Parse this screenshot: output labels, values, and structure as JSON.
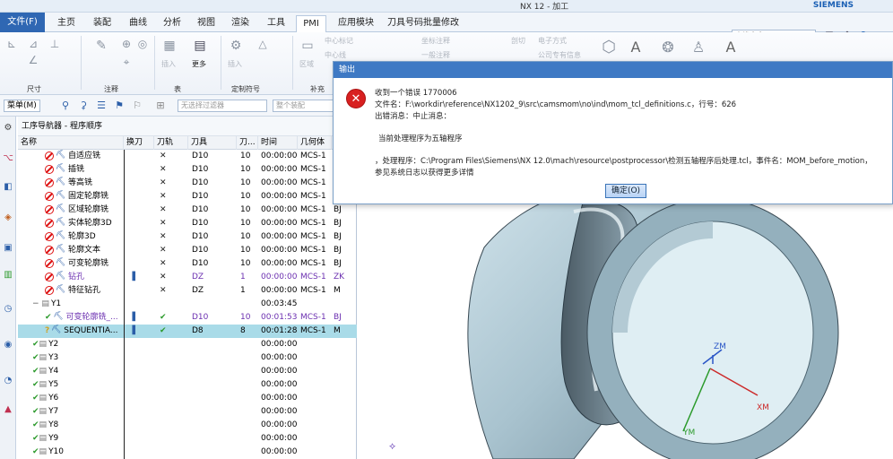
{
  "window": {
    "title": "NX 12 - 加工",
    "brand": "SIEMENS"
  },
  "ribbon": {
    "tabs": [
      "文件(F)",
      "主页",
      "装配",
      "曲线",
      "分析",
      "视图",
      "渲染",
      "工具",
      "PMI",
      "应用模块",
      "刀具号码批量修改"
    ],
    "active_tab": "PMI",
    "command_search_placeholder": "查找命令",
    "groups": [
      "尺寸",
      "注释",
      "表",
      "定制符号",
      "补充"
    ],
    "more_label": "更多",
    "small_labels": [
      "中心标记",
      "坐标注释",
      "一般注释",
      "中心线",
      "剖切",
      "公司专有信息",
      "电子方式",
      "区域",
      "插入",
      "插入"
    ]
  },
  "toolbar2": {
    "menu_label": "菜单(M)",
    "filter_placeholder": "无选择过滤器",
    "assembly_placeholder": "整个装配"
  },
  "navigator": {
    "title": "工序导航器 - 程序顺序",
    "columns": [
      "名称",
      "换刀",
      "刀轨",
      "刀具",
      "刀...",
      "时间",
      "几何体"
    ],
    "rows": [
      {
        "name": "自适应铣",
        "state": "stop",
        "path": "x",
        "tool": "D10",
        "num": "10",
        "time": "00:00:00",
        "geom": "MCS-1",
        "extra": "",
        "indent": 2,
        "style": ""
      },
      {
        "name": "插铣",
        "state": "stop",
        "path": "x",
        "tool": "D10",
        "num": "10",
        "time": "00:00:00",
        "geom": "MCS-1",
        "extra": "",
        "indent": 2,
        "style": ""
      },
      {
        "name": "等高铣",
        "state": "stop",
        "path": "x",
        "tool": "D10",
        "num": "10",
        "time": "00:00:00",
        "geom": "MCS-1",
        "extra": "",
        "indent": 2,
        "style": ""
      },
      {
        "name": "固定轮廓铣",
        "state": "stop",
        "path": "x",
        "tool": "D10",
        "num": "10",
        "time": "00:00:00",
        "geom": "MCS-1",
        "extra": "",
        "indent": 2,
        "style": ""
      },
      {
        "name": "区域轮廓铣",
        "state": "stop",
        "path": "x",
        "tool": "D10",
        "num": "10",
        "time": "00:00:00",
        "geom": "MCS-1",
        "extra": "BJ",
        "indent": 2,
        "style": ""
      },
      {
        "name": "实体轮廓3D",
        "state": "stop",
        "path": "x",
        "tool": "D10",
        "num": "10",
        "time": "00:00:00",
        "geom": "MCS-1",
        "extra": "BJ",
        "indent": 2,
        "style": ""
      },
      {
        "name": "轮廓3D",
        "state": "stop",
        "path": "x",
        "tool": "D10",
        "num": "10",
        "time": "00:00:00",
        "geom": "MCS-1",
        "extra": "BJ",
        "indent": 2,
        "style": ""
      },
      {
        "name": "轮廓文本",
        "state": "stop",
        "path": "x",
        "tool": "D10",
        "num": "10",
        "time": "00:00:00",
        "geom": "MCS-1",
        "extra": "BJ",
        "indent": 2,
        "style": ""
      },
      {
        "name": "可变轮廓铣",
        "state": "stop",
        "path": "x",
        "tool": "D10",
        "num": "10",
        "time": "00:00:00",
        "geom": "MCS-1",
        "extra": "BJ",
        "indent": 2,
        "style": ""
      },
      {
        "name": "钻孔",
        "state": "stop",
        "path": "x",
        "tool": "DZ",
        "num": "1",
        "time": "00:00:00",
        "geom": "MCS-1",
        "extra": "ZK",
        "indent": 2,
        "style": "purple",
        "toolchange": true
      },
      {
        "name": "特征钻孔",
        "state": "stop",
        "path": "x",
        "tool": "DZ",
        "num": "1",
        "time": "00:00:00",
        "geom": "MCS-1",
        "extra": "M",
        "indent": 2,
        "style": ""
      },
      {
        "name": "Y1",
        "state": "group",
        "path": "",
        "tool": "",
        "num": "",
        "time": "00:03:45",
        "geom": "",
        "extra": "",
        "indent": 1,
        "style": ""
      },
      {
        "name": "可变轮廓铣_...",
        "state": "ok",
        "path": "check",
        "tool": "D10",
        "num": "10",
        "time": "00:01:53",
        "geom": "MCS-1",
        "extra": "BJ",
        "indent": 2,
        "style": "purple",
        "toolchange": true
      },
      {
        "name": "SEQUENTIA...",
        "state": "warn",
        "path": "check",
        "tool": "D8",
        "num": "8",
        "time": "00:01:28",
        "geom": "MCS-1",
        "extra": "M",
        "indent": 2,
        "style": "sel",
        "toolchange": true
      },
      {
        "name": "Y2",
        "state": "okgroup",
        "path": "",
        "tool": "",
        "num": "",
        "time": "00:00:00",
        "geom": "",
        "extra": "",
        "indent": 1,
        "style": ""
      },
      {
        "name": "Y3",
        "state": "okgroup",
        "path": "",
        "tool": "",
        "num": "",
        "time": "00:00:00",
        "geom": "",
        "extra": "",
        "indent": 1,
        "style": ""
      },
      {
        "name": "Y4",
        "state": "okgroup",
        "path": "",
        "tool": "",
        "num": "",
        "time": "00:00:00",
        "geom": "",
        "extra": "",
        "indent": 1,
        "style": ""
      },
      {
        "name": "Y5",
        "state": "okgroup",
        "path": "",
        "tool": "",
        "num": "",
        "time": "00:00:00",
        "geom": "",
        "extra": "",
        "indent": 1,
        "style": ""
      },
      {
        "name": "Y6",
        "state": "okgroup",
        "path": "",
        "tool": "",
        "num": "",
        "time": "00:00:00",
        "geom": "",
        "extra": "",
        "indent": 1,
        "style": ""
      },
      {
        "name": "Y7",
        "state": "okgroup",
        "path": "",
        "tool": "",
        "num": "",
        "time": "00:00:00",
        "geom": "",
        "extra": "",
        "indent": 1,
        "style": ""
      },
      {
        "name": "Y8",
        "state": "okgroup",
        "path": "",
        "tool": "",
        "num": "",
        "time": "00:00:00",
        "geom": "",
        "extra": "",
        "indent": 1,
        "style": ""
      },
      {
        "name": "Y9",
        "state": "okgroup",
        "path": "",
        "tool": "",
        "num": "",
        "time": "00:00:00",
        "geom": "",
        "extra": "",
        "indent": 1,
        "style": ""
      },
      {
        "name": "Y10",
        "state": "okgroup",
        "path": "",
        "tool": "",
        "num": "",
        "time": "00:00:00",
        "geom": "",
        "extra": "",
        "indent": 1,
        "style": ""
      }
    ]
  },
  "dialog": {
    "title": "输出",
    "lines": [
      "收到一个错误 1770006",
      "文件名：F:\\workdir\\reference\\NX1202_9\\src\\camsmom\\no\\ind\\mom_tcl_definitions.c，行号：626",
      "出错消息：中止消息：",
      "当前处理程序为五轴程序",
      "，处理程序：C:\\Program Files\\Siemens\\NX 12.0\\mach\\resource\\postprocessor\\检测五轴程序后处理.tcl，事件名：MOM_before_motion，",
      "参见系统日志以获得更多详情"
    ],
    "ok_label": "确定(O)"
  },
  "viewport": {
    "axis_zm": "ZM",
    "axis_xm": "XM",
    "axis_ym": "YM"
  },
  "colors": {
    "accent": "#3e79c4",
    "file_tab": "#2f67b3",
    "selected_row": "#a9dbe8",
    "error": "#d82020"
  }
}
